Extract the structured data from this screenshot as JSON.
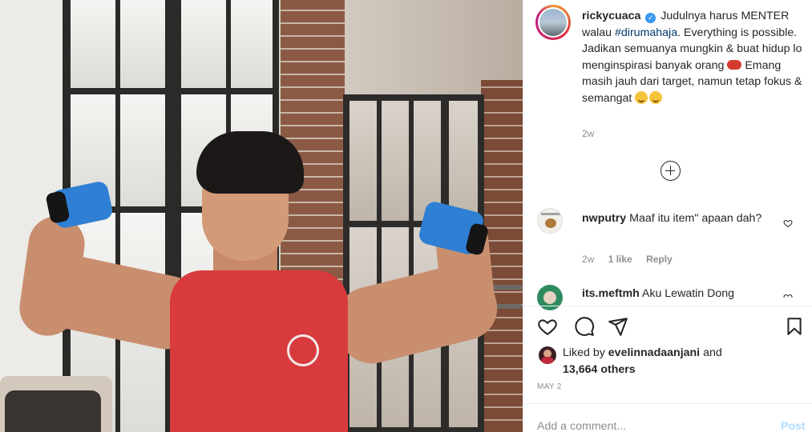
{
  "post": {
    "username": "rickycuaca",
    "verified": true,
    "caption_1": "Judulnya harus MENTER walau ",
    "hashtag": "#dirumahaja",
    "caption_2": ". Everything is possible. Jadikan semuanya mungkin & buat hidup lo menginspirasi banyak orang ",
    "caption_3": " Emang masih jauh dari target, namun tetap fokus & semangat",
    "caption_age": "2w",
    "emojis": [
      "flexed-biceps",
      "smiling-face",
      "smiling-face"
    ]
  },
  "comments": [
    {
      "username": "nwputry",
      "text": "Maaf itu item\" apaan dah?",
      "age": "2w",
      "likes": "1 like",
      "reply_label": "Reply"
    },
    {
      "username": "its.meftmh",
      "text": "Aku Lewatin Dong"
    }
  ],
  "actions": {
    "like_icon": "heart-icon",
    "comment_icon": "comment-icon",
    "share_icon": "paper-plane-icon",
    "save_icon": "bookmark-icon"
  },
  "likes": {
    "prefix": "Liked by ",
    "liker": "evelinnadaanjani",
    "middle": " and",
    "others": "13,664 others"
  },
  "date": "MAY 2",
  "add_comment": {
    "placeholder": "Add a comment...",
    "post_label": "Post"
  },
  "colors": {
    "accent": "#3897f0",
    "hashtag": "#00376b",
    "muted": "#8e8e8e",
    "post_disabled": "#b3dbff"
  }
}
